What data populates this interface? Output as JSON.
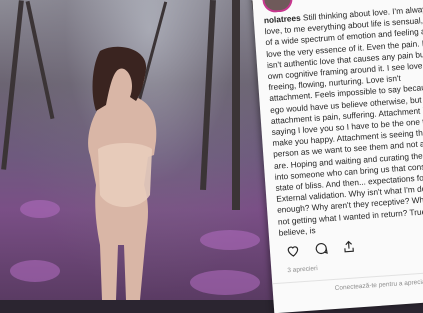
{
  "post": {
    "username": "nolatrees",
    "caption": "Still thinking about love. I'm always in love, to me everything about life is sensual, full of a wide spectrum of emotion and feeling and I love the very essence of it. Even the pain. It isn't authentic love that causes any pain but our own cognitive framing around it. I see love as freeing, flowing, nurturing. Love isn't attachment. Feels impossible to say because ego would have us believe otherwise, but attachment is pain, suffering. Attachment is saying I love you so I have to be the one to make you happy. Attachment is seeing the person as we want to see them and not as they are. Hoping and waiting and curating them or it into someone who can bring us that constant state of bliss. And then... expectations follow. External validation. Why isn't what I'm doing enough? Why aren't they receptive? Why am I not getting what I wanted in return? True love, I believe, is",
    "stat_text": "3 aprecieri",
    "footer_text": "Conectează-te pentru a aprecia sau"
  },
  "icons": [
    "heart-icon",
    "comment-icon",
    "share-icon"
  ],
  "colors": {
    "card_bg": "#fafafa",
    "text": "#262626",
    "muted": "#8e8e8e",
    "avatar_ring": "#c8378f"
  }
}
